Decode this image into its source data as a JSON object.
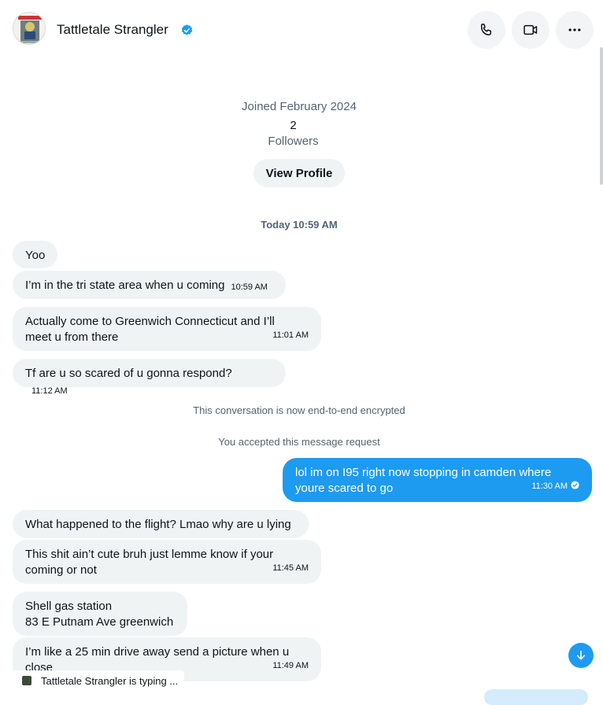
{
  "header": {
    "contact_name": "Tattletale Strangler",
    "verified": true,
    "call_button": "phone-icon",
    "video_button": "video-icon",
    "more_button": "more-icon"
  },
  "profile_card": {
    "joined": "Joined February 2024",
    "followers_count": "2",
    "followers_label": "Followers",
    "view_profile_label": "View Profile"
  },
  "conversation": {
    "date_divider": "Today 10:59 AM",
    "messages": [
      {
        "dir": "in",
        "text": "Yoo",
        "time": ""
      },
      {
        "dir": "in",
        "text": "I’m in the tri state area when u coming",
        "time": "10:59 AM"
      },
      {
        "dir": "in",
        "text": "Actually come to Greenwich Connecticut and I’ll meet u from there",
        "time": "11:01 AM"
      },
      {
        "dir": "in",
        "text": "Tf are u so scared of u gonna respond?",
        "time": "11:12 AM"
      },
      {
        "dir": "out",
        "text": "lol im on I95 right now stopping in camden where youre scared to go",
        "time": "11:30 AM"
      },
      {
        "dir": "in",
        "text": "What happened to the flight? Lmao why are u lying",
        "time": ""
      },
      {
        "dir": "in",
        "text": "This shit ain’t cute bruh just lemme know if your coming or not",
        "time": "11:45 AM"
      },
      {
        "dir": "in",
        "text_line1": "Shell gas station",
        "text_line2": "83 E Putnam Ave greenwich",
        "time": ""
      },
      {
        "dir": "in",
        "text": "I’m like a 25 min drive away send a picture when u close",
        "time": "11:49 AM"
      }
    ],
    "system_messages": {
      "encrypted": "This conversation is now end-to-end encrypted",
      "accepted": "You accepted this message request"
    },
    "typing_indicator": "Tattletale Strangler is typing ..."
  },
  "colors": {
    "accent": "#1d9bf0",
    "incoming_bubble": "#eff3f4",
    "muted_text": "#536471"
  }
}
